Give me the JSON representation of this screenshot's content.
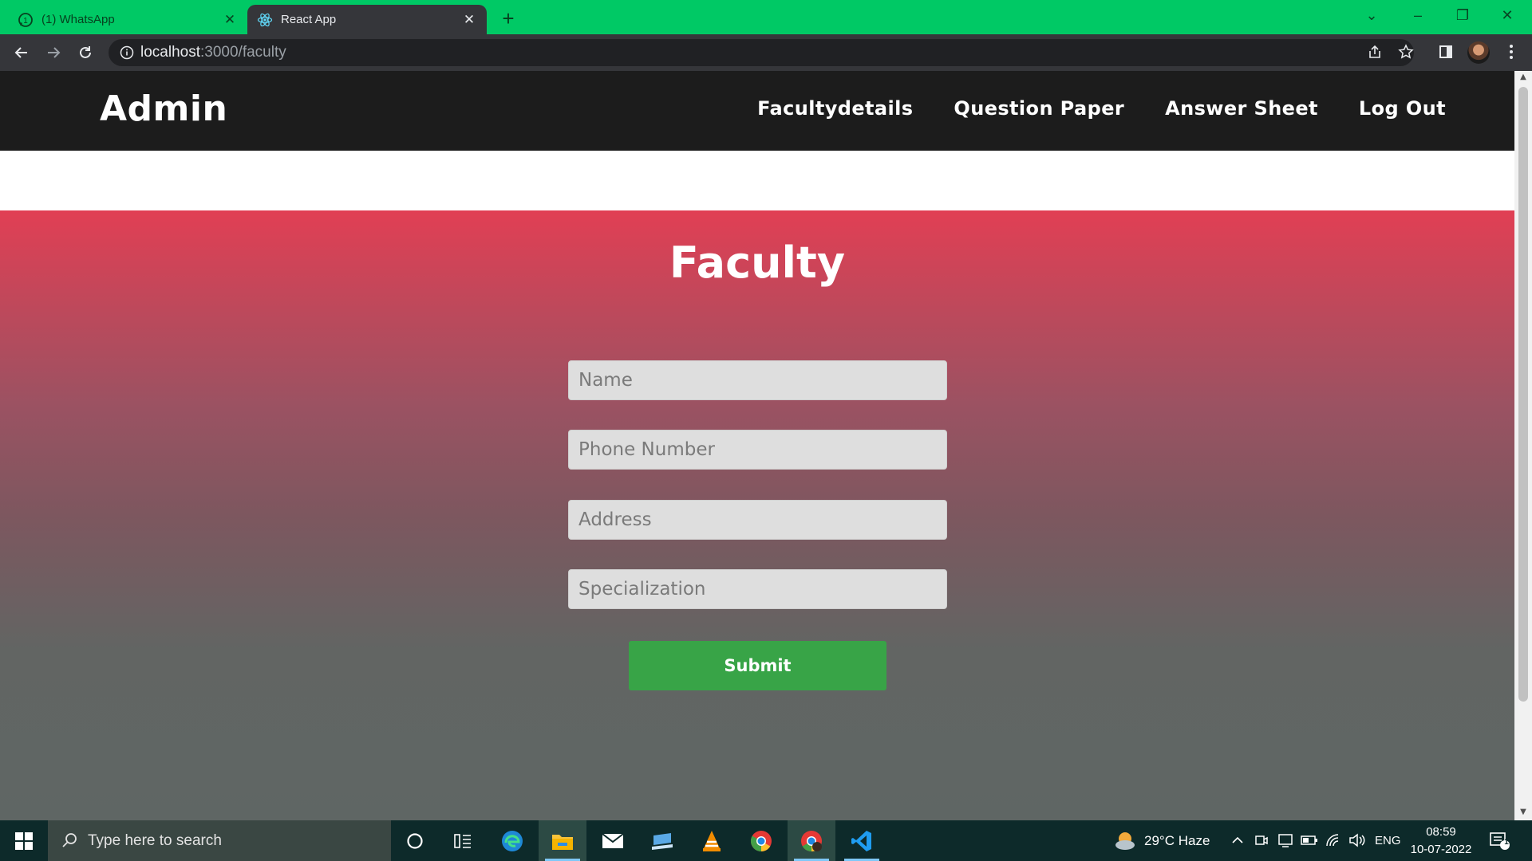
{
  "browser": {
    "tabs": [
      {
        "title": "(1) WhatsApp",
        "icon": "whatsapp-icon",
        "active": false
      },
      {
        "title": "React App",
        "icon": "react-icon",
        "active": true
      }
    ],
    "url_host": "localhost",
    "url_path": ":3000/faculty"
  },
  "page": {
    "brand": "Admin",
    "nav": [
      "Facultydetails",
      "Question Paper",
      "Answer Sheet",
      "Log Out"
    ],
    "title": "Faculty",
    "form": {
      "name_placeholder": "Name",
      "phone_placeholder": "Phone Number",
      "address_placeholder": "Address",
      "specialization_placeholder": "Specialization",
      "submit_label": "Submit"
    },
    "colors": {
      "navbar": "#1c1c1c",
      "gradient_top": "#e13f54",
      "gradient_bottom": "#5f6664",
      "submit": "#38a447"
    }
  },
  "taskbar": {
    "search_placeholder": "Type here to search",
    "weather": "29°C  Haze",
    "language": "ENG",
    "time": "08:59",
    "date": "10-07-2022",
    "notification_count": "1"
  }
}
